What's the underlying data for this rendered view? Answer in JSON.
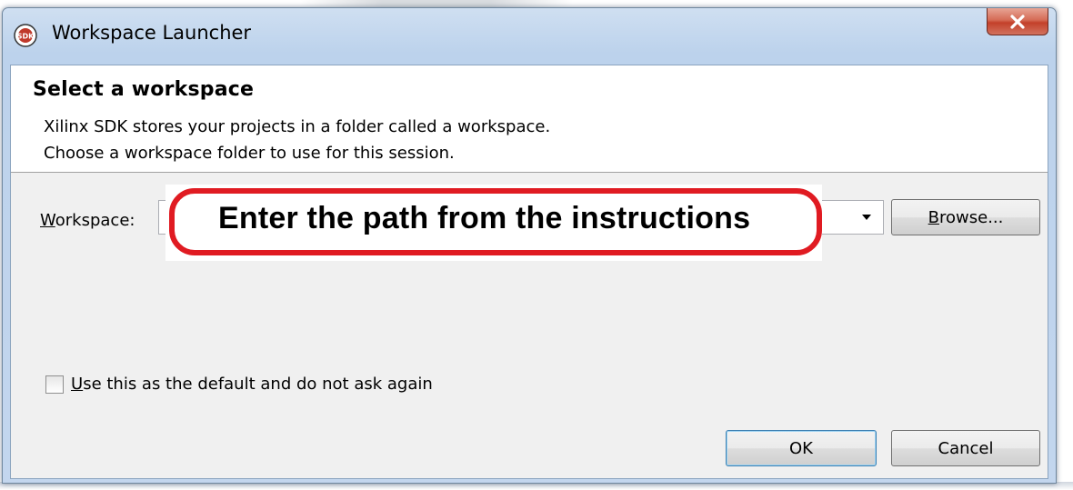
{
  "window": {
    "title": "Workspace Launcher",
    "icon": "sdk-logo-icon",
    "close_icon": "close-icon"
  },
  "header": {
    "title": "Select a workspace",
    "line1": "Xilinx SDK stores your projects in a folder called a workspace.",
    "line2": "Choose a workspace folder to use for this session."
  },
  "workspace": {
    "label_underlined": "W",
    "label_rest": "orkspace:",
    "value": "",
    "dropdown_icon": "chevron-down-icon"
  },
  "annotation": {
    "text": "Enter the path from the instructions",
    "color": "#e01b22"
  },
  "buttons": {
    "browse_underlined": "B",
    "browse_rest": "rowse...",
    "ok": "OK",
    "cancel": "Cancel"
  },
  "default_checkbox": {
    "label_underlined": "U",
    "label_rest": "se this as the default and do not ask again",
    "checked": false
  },
  "colors": {
    "titlebar": "#c3d6ee",
    "close_button": "#c3402a",
    "dialog_body": "#f0f0f0"
  }
}
